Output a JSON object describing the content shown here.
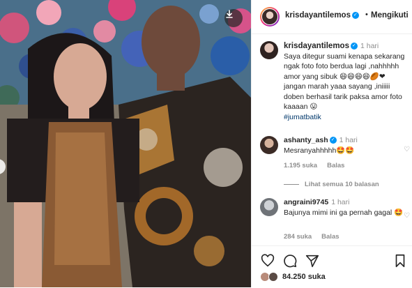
{
  "post": {
    "author": "krisdayantilemos",
    "follow_label": "Mengikuti",
    "caption_time": "1 hari",
    "caption_text": "Saya ditegur suami kenapa sekarang ngak foto foto berdua lagi ,nahhhhh amor yang sibuk 😄😄😄😄🏉❤ jangan marah yaaa sayang ,iniiiii doben berhasil tarik paksa amor foto kaaaan 😛",
    "hashtag": "#jumatbatik"
  },
  "comments": [
    {
      "user": "ashanty_ash",
      "time": "1 hari",
      "text": "Mesranyahhhhh🤩🤩",
      "likes": "1.195 suka",
      "reply_label": "Balas"
    },
    {
      "user": "angraini9745",
      "time": "1 hari",
      "text": "Bajunya mimi ini ga pernah gagal 🤩",
      "likes": "284 suka",
      "reply_label": "Balas"
    }
  ],
  "view_replies": "Lihat semua 10 balasan",
  "footer": {
    "likes_count": "84.250 suka"
  },
  "icons": [
    "download-icon",
    "verified-icon",
    "heart-icon",
    "comment-icon",
    "share-icon",
    "save-icon"
  ],
  "colors": {
    "verified": "#0095f6",
    "hashtag": "#00376b",
    "muted": "#8e8e8e"
  }
}
